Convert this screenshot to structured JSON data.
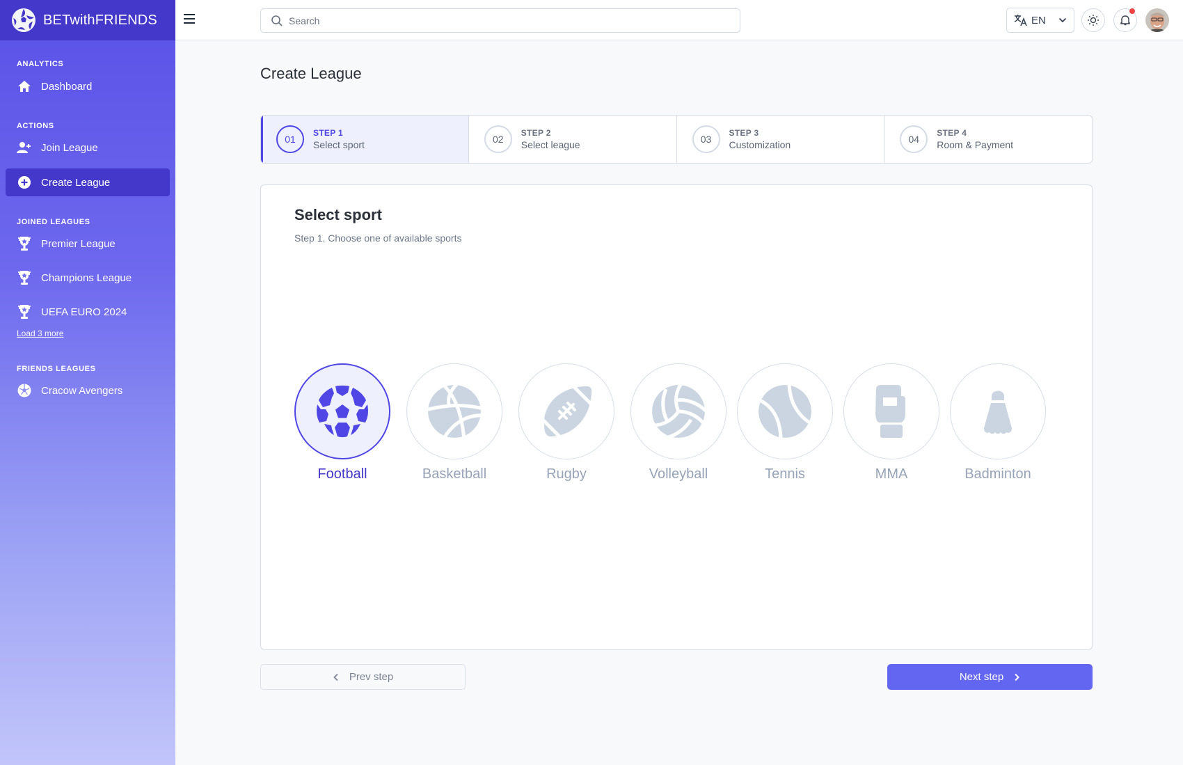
{
  "brand": {
    "name": "BETwithFRIENDS"
  },
  "sidebar": {
    "sections": [
      {
        "title": "ANALYTICS"
      },
      {
        "title": "ACTIONS"
      },
      {
        "title": "JOINED LEAGUES"
      },
      {
        "title": "FRIENDS LEAGUES"
      }
    ],
    "items": [
      {
        "label": "Dashboard",
        "icon": "home-icon"
      },
      {
        "label": "Join League",
        "icon": "user-plus-icon"
      },
      {
        "label": "Create League",
        "icon": "plus-circle-icon",
        "active": true
      },
      {
        "label": "Premier League",
        "icon": "trophy-icon"
      },
      {
        "label": "Champions League",
        "icon": "trophy-icon"
      },
      {
        "label": "UEFA EURO 2024",
        "icon": "trophy-icon"
      },
      {
        "label": "Cracow Avengers",
        "icon": "soccer-ball-icon"
      }
    ],
    "load_more": "Load 3 more"
  },
  "topbar": {
    "search_placeholder": "Search",
    "language": "EN",
    "has_notification": true
  },
  "page": {
    "title": "Create League",
    "steps": [
      {
        "num": "01",
        "kicker": "STEP 1",
        "label": "Select sport",
        "active": true
      },
      {
        "num": "02",
        "kicker": "STEP 2",
        "label": "Select league"
      },
      {
        "num": "03",
        "kicker": "STEP 3",
        "label": "Customization"
      },
      {
        "num": "04",
        "kicker": "STEP 4",
        "label": "Room & Payment"
      }
    ],
    "card": {
      "title": "Select sport",
      "subtitle": "Step 1. Choose one of available sports"
    },
    "sports": [
      {
        "name": "Football",
        "icon": "soccer-ball-icon",
        "selected": true
      },
      {
        "name": "Basketball",
        "icon": "basketball-icon"
      },
      {
        "name": "Rugby",
        "icon": "rugby-ball-icon"
      },
      {
        "name": "Volleyball",
        "icon": "volleyball-icon"
      },
      {
        "name": "Tennis",
        "icon": "tennis-ball-icon"
      },
      {
        "name": "MMA",
        "icon": "boxing-glove-icon"
      },
      {
        "name": "Badminton",
        "icon": "shuttlecock-icon"
      }
    ],
    "prev_label": "Prev step",
    "next_label": "Next step"
  },
  "colors": {
    "accent": "#4f46e5",
    "accent_dark": "#4338ca",
    "button_primary": "#6366f1",
    "icon_muted": "#cbd5e1",
    "notification": "#ef4444"
  }
}
